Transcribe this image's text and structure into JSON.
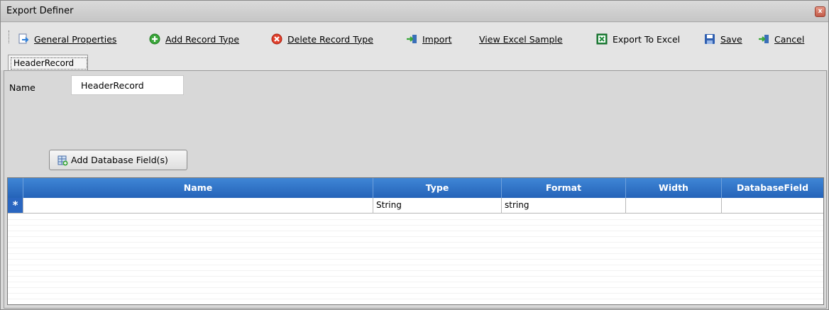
{
  "window": {
    "title": "Export Definer",
    "close_glyph": "x"
  },
  "toolbar": {
    "general_properties": "General Properties",
    "add_record_type": "Add Record Type",
    "delete_record_type": "Delete Record Type",
    "import": "Import",
    "view_excel_sample": "View Excel Sample",
    "export_to_excel": "Export To Excel",
    "save": "Save",
    "cancel": "Cancel"
  },
  "tabs": [
    {
      "label": "HeaderRecord",
      "selected": true
    }
  ],
  "record": {
    "name_label": "Name",
    "name_value": "HeaderRecord",
    "add_db_fields_label": "Add Database Field(s)"
  },
  "grid": {
    "columns": [
      "Name",
      "Type",
      "Format",
      "Width",
      "DatabaseField"
    ],
    "new_row_marker": "*",
    "new_row": {
      "name": "",
      "type": "String",
      "format": "string",
      "width": "",
      "database_field": ""
    }
  },
  "colors": {
    "grid_header": "#2f72c8",
    "title_bar": "#cfcfcf",
    "window_bg": "#d8d8d8"
  },
  "icons": {
    "general_properties": "page-arrow-icon",
    "add_record_type": "green-plus-circle-icon",
    "delete_record_type": "red-x-circle-icon",
    "import": "import-arrow-icon",
    "export_to_excel": "excel-icon",
    "save": "floppy-disk-icon",
    "cancel": "cancel-arrow-icon",
    "add_db_fields": "database-add-icon"
  }
}
